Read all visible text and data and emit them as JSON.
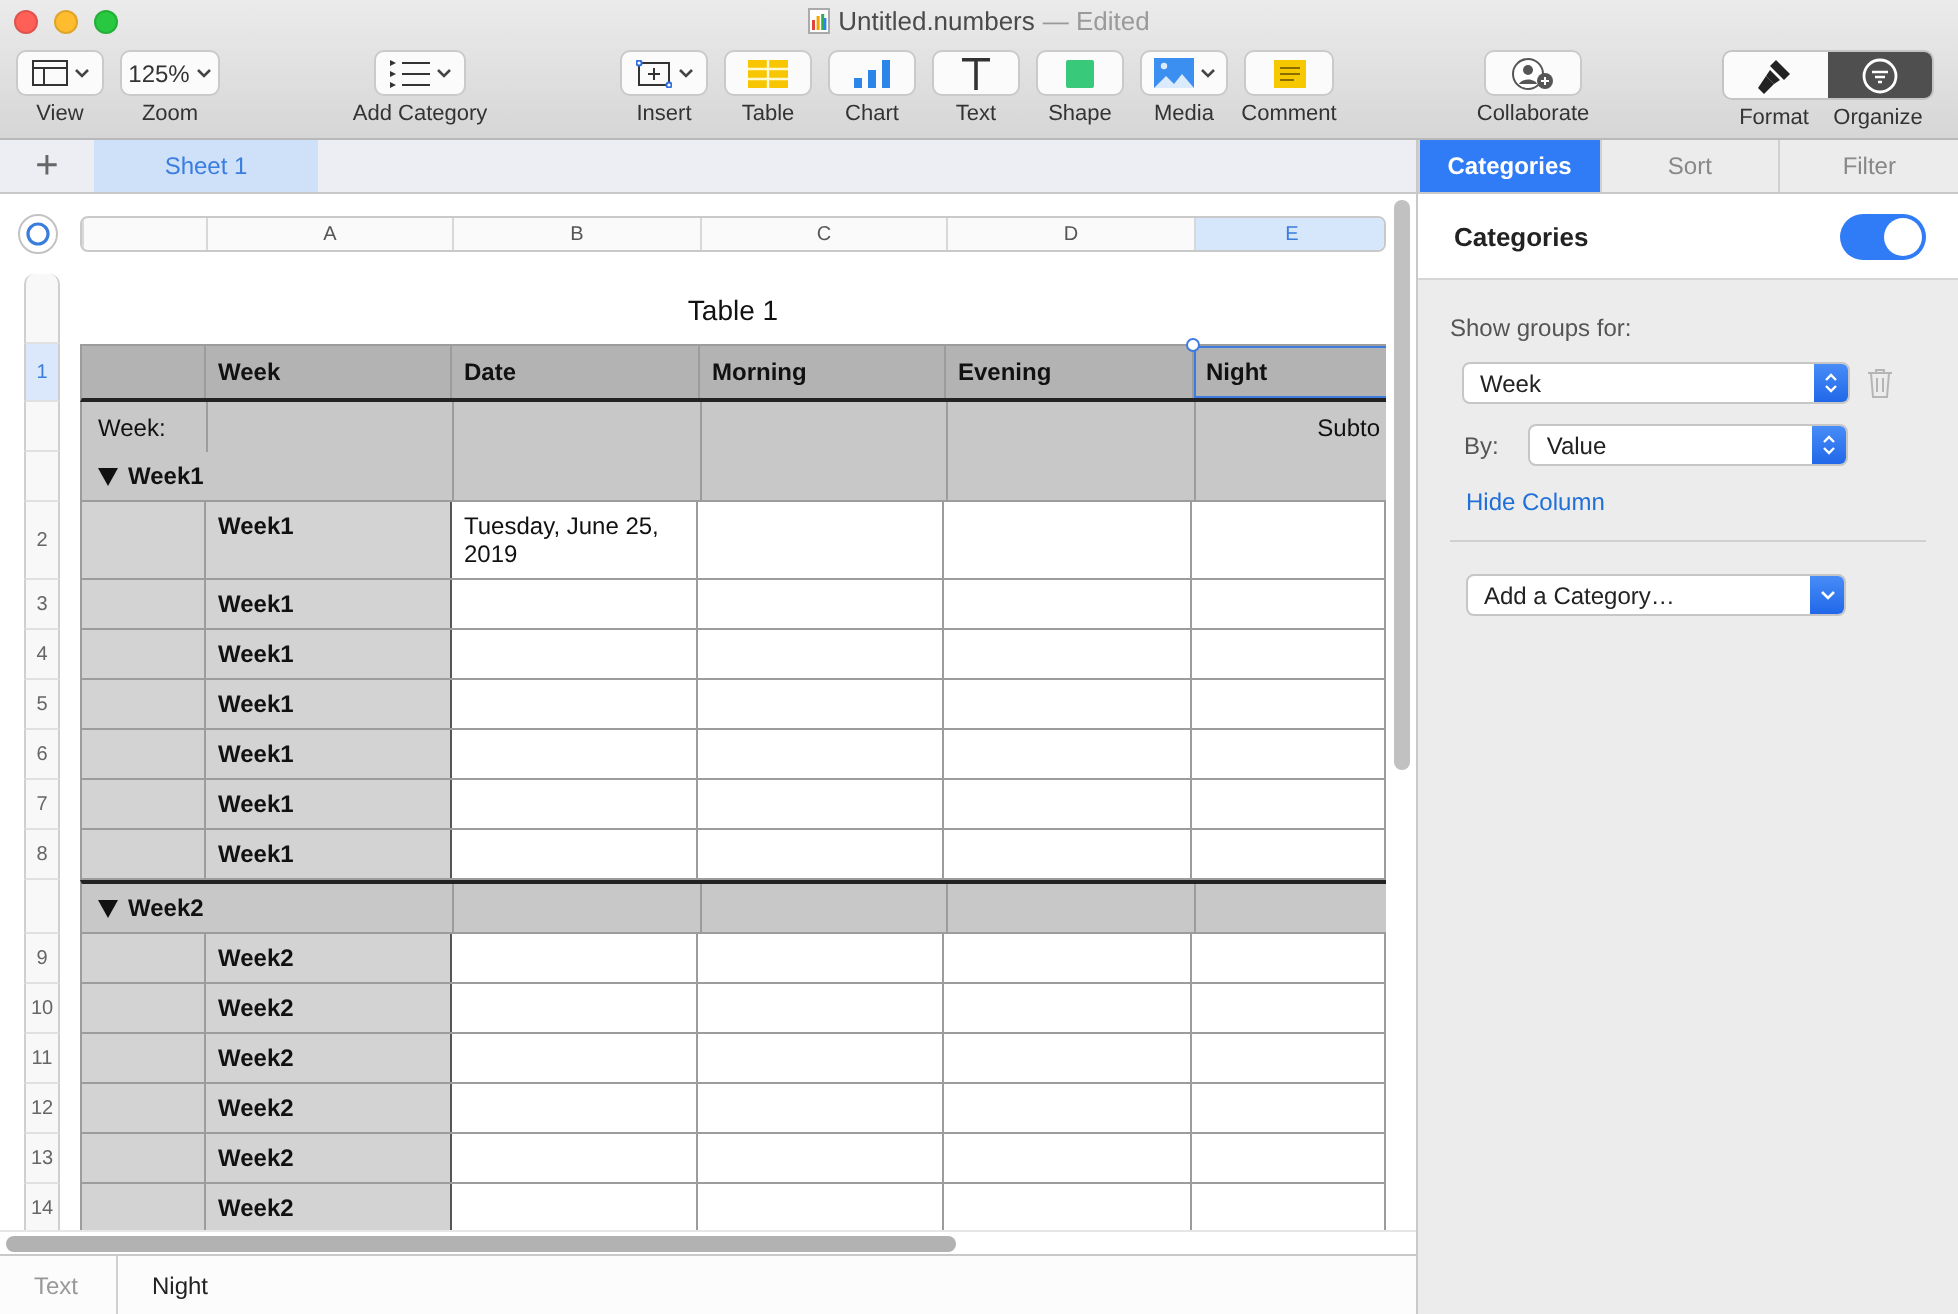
{
  "window": {
    "title": "Untitled.numbers",
    "status": "— Edited"
  },
  "toolbar": {
    "left": [
      {
        "kind": "view",
        "label": "View",
        "menu": true
      },
      {
        "kind": "zoom",
        "label": "Zoom",
        "value": "125%",
        "menu": true
      }
    ],
    "category": [
      {
        "kind": "category",
        "label": "Add Category",
        "menu": true
      }
    ],
    "insert": [
      {
        "kind": "insert",
        "label": "Insert",
        "menu": true
      },
      {
        "kind": "table",
        "label": "Table"
      },
      {
        "kind": "chart",
        "label": "Chart"
      },
      {
        "kind": "text",
        "label": "Text"
      },
      {
        "kind": "shape",
        "label": "Shape"
      },
      {
        "kind": "media",
        "label": "Media",
        "menu": true
      },
      {
        "kind": "comment",
        "label": "Comment"
      }
    ],
    "share": [
      {
        "kind": "collaborate",
        "label": "Collaborate"
      }
    ],
    "inspector_switch": [
      {
        "kind": "format",
        "label": "Format",
        "selected": false
      },
      {
        "kind": "organize",
        "label": "Organize",
        "selected": true
      }
    ]
  },
  "sheet_tabs": {
    "add": "+",
    "tabs": [
      {
        "label": "Sheet 1",
        "selected": true
      }
    ]
  },
  "columns": [
    {
      "label": "A",
      "selected": false
    },
    {
      "label": "B",
      "selected": false
    },
    {
      "label": "C",
      "selected": false
    },
    {
      "label": "D",
      "selected": false
    },
    {
      "label": "E",
      "selected": true
    }
  ],
  "table": {
    "title": "Table 1",
    "header": {
      "number": "1",
      "selected": true,
      "columns": [
        {
          "label": "Week",
          "selected": false
        },
        {
          "label": "Date",
          "selected": false
        },
        {
          "label": "Morning",
          "selected": false
        },
        {
          "label": "Evening",
          "selected": false
        },
        {
          "label": "Night",
          "selected": true
        }
      ]
    },
    "summary": {
      "label": "Week:",
      "subtotal": "Subto"
    },
    "groups": [
      {
        "name": "Week1",
        "expanded": true,
        "rows": [
          {
            "number": "2",
            "week": "Week1",
            "date": "Tuesday, June 25, 2019"
          },
          {
            "number": "3",
            "week": "Week1"
          },
          {
            "number": "4",
            "week": "Week1"
          },
          {
            "number": "5",
            "week": "Week1"
          },
          {
            "number": "6",
            "week": "Week1"
          },
          {
            "number": "7",
            "week": "Week1"
          },
          {
            "number": "8",
            "week": "Week1"
          }
        ]
      },
      {
        "name": "Week2",
        "expanded": true,
        "rows": [
          {
            "number": "9",
            "week": "Week2"
          },
          {
            "number": "10",
            "week": "Week2"
          },
          {
            "number": "11",
            "week": "Week2"
          },
          {
            "number": "12",
            "week": "Week2"
          },
          {
            "number": "13",
            "week": "Week2"
          },
          {
            "number": "14",
            "week": "Week2"
          }
        ]
      }
    ]
  },
  "inspector": {
    "tabs": [
      {
        "label": "Categories",
        "selected": true
      },
      {
        "label": "Sort",
        "selected": false
      },
      {
        "label": "Filter",
        "selected": false
      }
    ],
    "categories": {
      "label": "Categories",
      "on": true
    },
    "show_groups_label": "Show groups for:",
    "group_by": {
      "value": "Week"
    },
    "by": {
      "label": "By:",
      "value": "Value"
    },
    "hide_column": "Hide Column",
    "add_category": "Add a Category…"
  },
  "formula_bar": {
    "label": "Text",
    "value": "Night"
  }
}
